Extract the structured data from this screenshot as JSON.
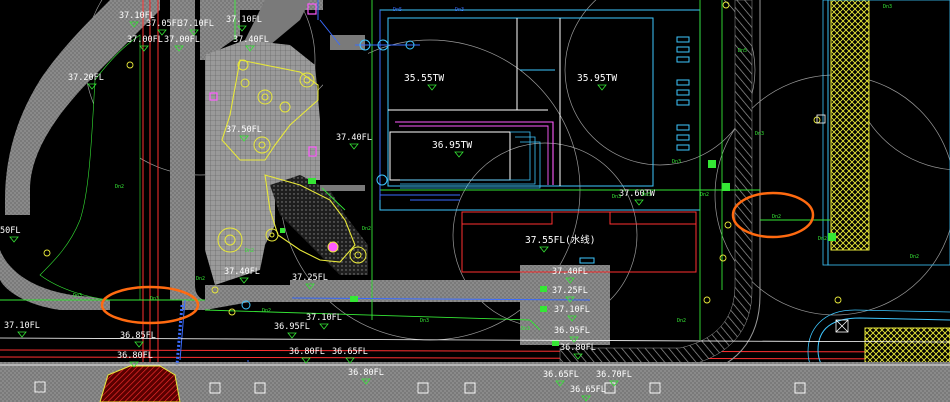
{
  "drawing": {
    "colors": {
      "background": "#000000",
      "paving": "#8c8c8c",
      "building_outline": "#3ec7ff",
      "building_inner": "#ff5cff",
      "red_line": "#ff3030",
      "green_line": "#35e635",
      "blue_line": "#3a6cff",
      "yellow_line": "#e8e83a",
      "markup_ellipse": "#ff6a10"
    },
    "elevation_labels": {
      "e01": "37.10FL",
      "e02": "37.05FL",
      "e03": "37.10FL",
      "e04": "37.10FL",
      "e05": "37.00FL",
      "e06": "37.00FL",
      "e07": "37.40FL",
      "e08": "37.20FL",
      "e09": "37.50FL",
      "e10": "37.40FL",
      "e11": "35.55TW",
      "e12": "35.95TW",
      "e13": "36.95TW",
      "e14": "37.60TW",
      "e15": "37.55FL(水线)",
      "e16": "37.40FL",
      "e17": "37.25FL",
      "e18": "37.10FL",
      "e19": "37.40FL",
      "e20": "37.25FL",
      "e21": "37.10FL",
      "e22": "36.95FL",
      "e23": "36.95FL",
      "e24": "36.85FL",
      "e25": "36.80FL",
      "e26": "36.80FL",
      "e27": "36.65FL",
      "e28": "36.80FL",
      "e29": "36.80FL",
      "e30": "36.65FL",
      "e31": "36.70FL",
      "e32": "36.65FL",
      "e33": "37.10FL",
      "e34": "50FL"
    },
    "small_labels": {
      "s01": "Dn5",
      "s02": "Dn3",
      "s03": "Dn5",
      "s04": "Dn3",
      "s05": "Dn3",
      "s06": "Dn2",
      "s07": "Dn2",
      "s08": "Dn2",
      "s09": "Dn3",
      "s10": "Dn3",
      "s11": "Dn2",
      "s12": "Dn2",
      "s13": "Dn3",
      "s14": "Dn3",
      "s15": "Dn2",
      "s16": "Dn2",
      "s17": "Dn2",
      "s18": "Dn5",
      "s19": "Dn3",
      "s20": "Dn3",
      "s21": "Dn2",
      "s22": "Dn2"
    }
  }
}
